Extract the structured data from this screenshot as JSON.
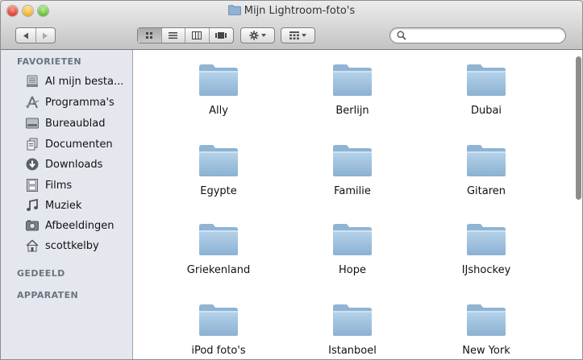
{
  "window": {
    "title": "Mijn Lightroom-foto's"
  },
  "toolbar": {
    "nav": [
      "◀",
      "▶"
    ],
    "views": [
      "icon-view",
      "list-view",
      "column-view",
      "coverflow-view"
    ],
    "action_label": "✱▾",
    "arrange_label": "▾"
  },
  "sidebar": {
    "favorites_header": "FAVORIETEN",
    "items": [
      {
        "label": "Al mijn besta...",
        "icon": "all-files-icon"
      },
      {
        "label": "Programma's",
        "icon": "applications-icon"
      },
      {
        "label": "Bureaublad",
        "icon": "desktop-icon"
      },
      {
        "label": "Documenten",
        "icon": "documents-icon"
      },
      {
        "label": "Downloads",
        "icon": "downloads-icon"
      },
      {
        "label": "Films",
        "icon": "movies-icon"
      },
      {
        "label": "Muziek",
        "icon": "music-icon"
      },
      {
        "label": "Afbeeldingen",
        "icon": "pictures-icon"
      },
      {
        "label": "scottkelby",
        "icon": "home-icon"
      }
    ],
    "shared_header": "GEDEELD",
    "devices_header": "APPARATEN"
  },
  "folders": [
    "Ally",
    "Berlijn",
    "Dubai",
    "Egypte",
    "Familie",
    "Gitaren",
    "Griekenland",
    "Hope",
    "IJshockey",
    "iPod foto's",
    "Istanboel",
    "New York"
  ],
  "colors": {
    "sidebar_bg": "#e4e8ee",
    "folder": "#9fc1dc",
    "section_header": "#6b7380"
  }
}
